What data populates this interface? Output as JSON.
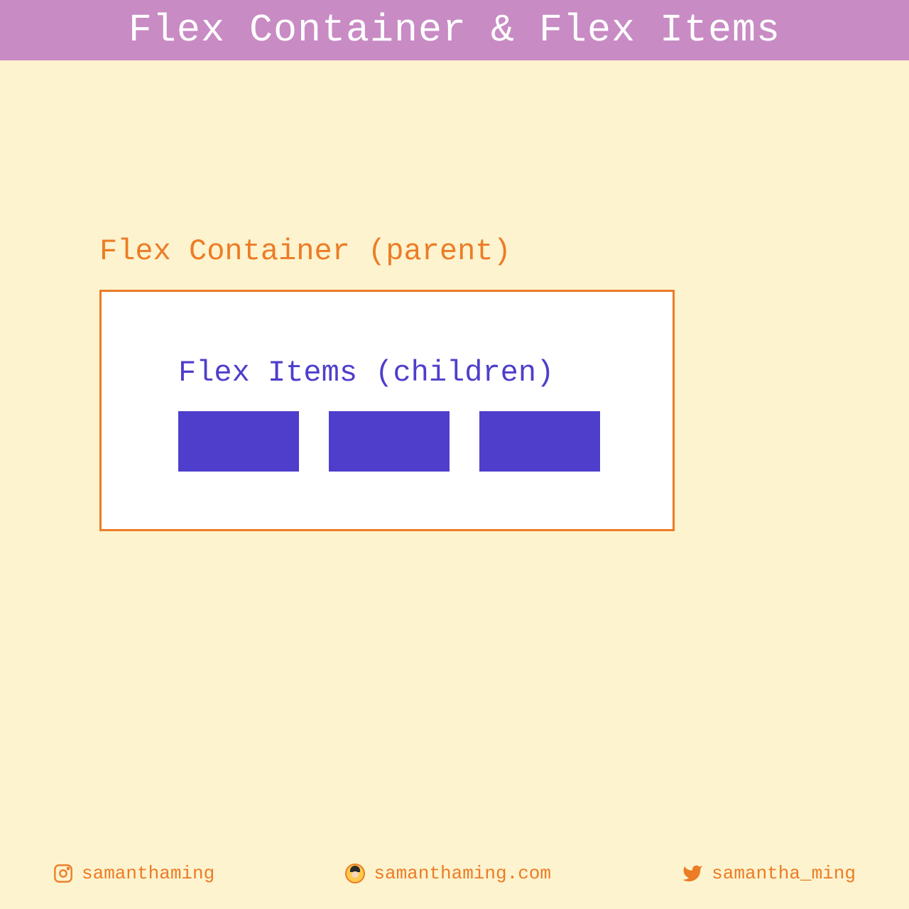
{
  "header": {
    "title": "Flex Container & Flex Items"
  },
  "diagram": {
    "container_label": "Flex Container (parent)",
    "items_label": "Flex Items (children)"
  },
  "footer": {
    "instagram": "samanthaming",
    "website": "samanthaming.com",
    "twitter": "samantha_ming"
  },
  "colors": {
    "header_bg": "#C88BC4",
    "page_bg": "#FDF3CE",
    "orange": "#EC7C26",
    "purple": "#4E3ECB",
    "white": "#FFFFFF"
  }
}
